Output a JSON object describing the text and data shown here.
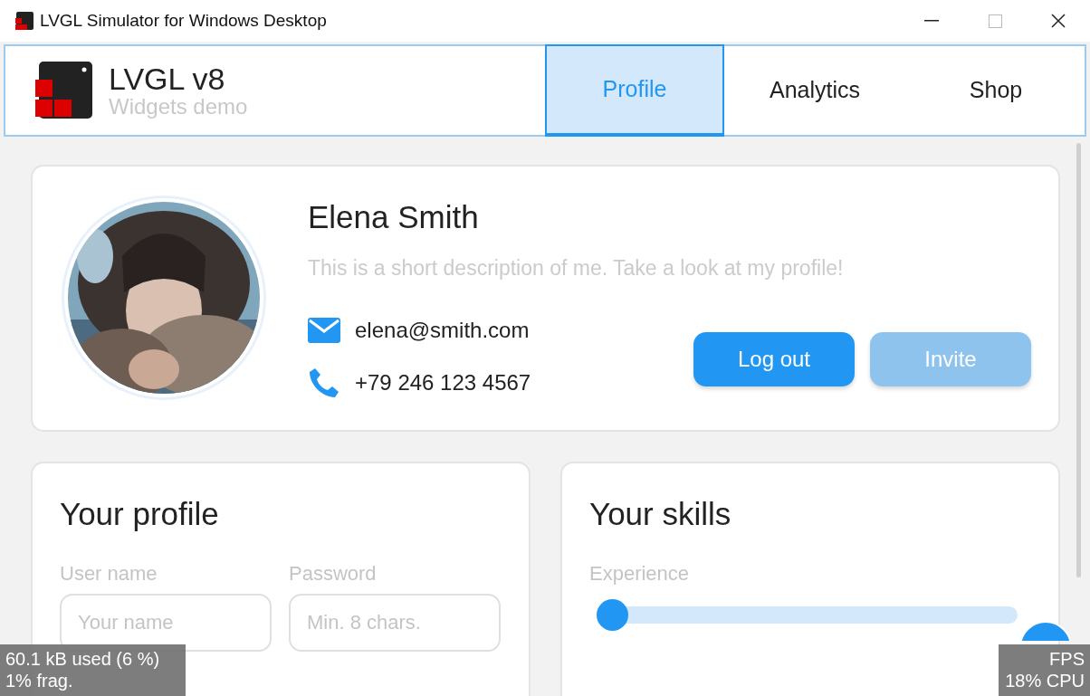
{
  "window": {
    "title": "LVGL Simulator for Windows Desktop"
  },
  "header": {
    "title": "LVGL v8",
    "subtitle": "Widgets demo"
  },
  "tabs": [
    {
      "label": "Profile",
      "selected": true
    },
    {
      "label": "Analytics",
      "selected": false
    },
    {
      "label": "Shop",
      "selected": false
    }
  ],
  "profile_card": {
    "name": "Elena Smith",
    "description": "This is a short description of me. Take a look at my profile!",
    "email": "elena@smith.com",
    "phone": "+79 246 123 4567",
    "buttons": [
      {
        "label": "Log out",
        "disabled": false
      },
      {
        "label": "Invite",
        "disabled": true
      }
    ]
  },
  "your_profile": {
    "title": "Your profile",
    "fields": [
      {
        "label": "User name",
        "placeholder": "Your name"
      },
      {
        "label": "Password",
        "placeholder": "Min. 8 chars."
      }
    ]
  },
  "your_skills": {
    "title": "Your skills",
    "slider": {
      "label": "Experience",
      "level": 0
    }
  },
  "monitor": {
    "memory": [
      "60.1 kB used (6 %)",
      "1% frag."
    ],
    "performance": [
      "FPS",
      "18% CPU"
    ]
  }
}
